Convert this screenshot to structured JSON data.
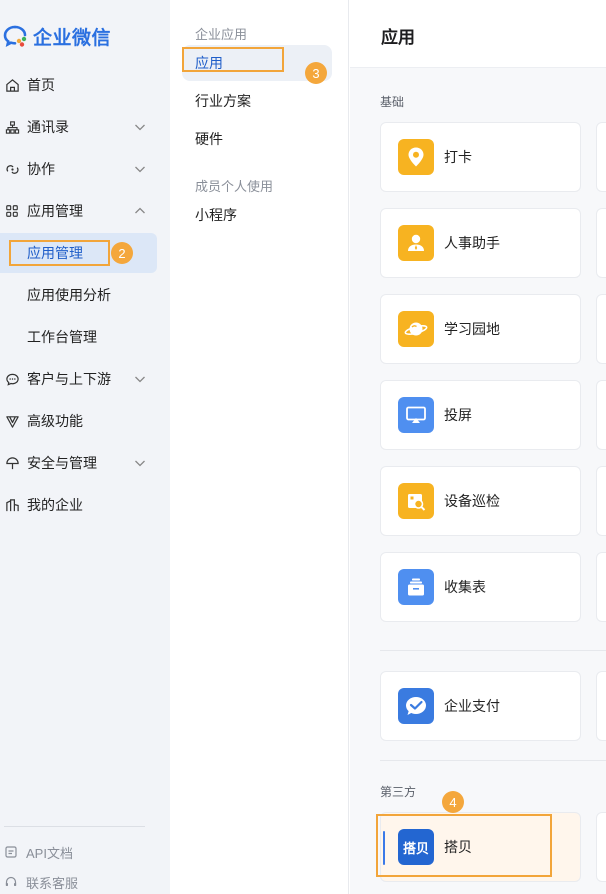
{
  "app": {
    "title": "企业微信",
    "brand_color": "#2b70e0",
    "accent_color": "#f4a73c"
  },
  "sidebar": {
    "items": [
      {
        "label": "首页",
        "icon": "home-icon"
      },
      {
        "label": "通讯录",
        "icon": "org-chart-icon",
        "expandable": true
      },
      {
        "label": "协作",
        "icon": "collab-icon",
        "expandable": true
      },
      {
        "label": "应用管理",
        "icon": "apps-grid-icon",
        "expanded": true
      },
      {
        "label": "应用管理",
        "sub": true,
        "active": true
      },
      {
        "label": "应用使用分析",
        "sub": true
      },
      {
        "label": "工作台管理",
        "sub": true
      },
      {
        "label": "客户与上下游",
        "icon": "chat-bubble-icon",
        "expandable": true
      },
      {
        "label": "高级功能",
        "icon": "triangle-icon"
      },
      {
        "label": "安全与管理",
        "icon": "umbrella-icon",
        "expandable": true
      },
      {
        "label": "我的企业",
        "icon": "building-icon"
      }
    ],
    "footer": [
      {
        "label": "API文档",
        "icon": "doc-icon"
      },
      {
        "label": "联系客服",
        "icon": "headset-icon"
      }
    ]
  },
  "midnav": {
    "group1": "企业应用",
    "items1": [
      "应用",
      "行业方案",
      "硬件"
    ],
    "group2": "成员个人使用",
    "items2": [
      "小程序"
    ]
  },
  "main": {
    "title": "应用",
    "sections": {
      "basic": "基础",
      "third": "第三方"
    },
    "basic_apps": [
      {
        "name": "打卡",
        "icon": "location-pin-icon"
      },
      {
        "name": "人事助手",
        "icon": "person-icon"
      },
      {
        "name": "学习园地",
        "icon": "planet-icon"
      },
      {
        "name": "投屏",
        "icon": "screen-cast-icon"
      },
      {
        "name": "设备巡检",
        "icon": "device-inspect-icon"
      },
      {
        "name": "收集表",
        "icon": "form-stack-icon"
      }
    ],
    "pay_app": {
      "name": "企业支付",
      "icon": "pay-check-icon"
    },
    "third_apps": [
      {
        "name": "搭贝",
        "icon_text": "搭贝"
      }
    ]
  },
  "annotations": [
    "2",
    "3",
    "4"
  ]
}
